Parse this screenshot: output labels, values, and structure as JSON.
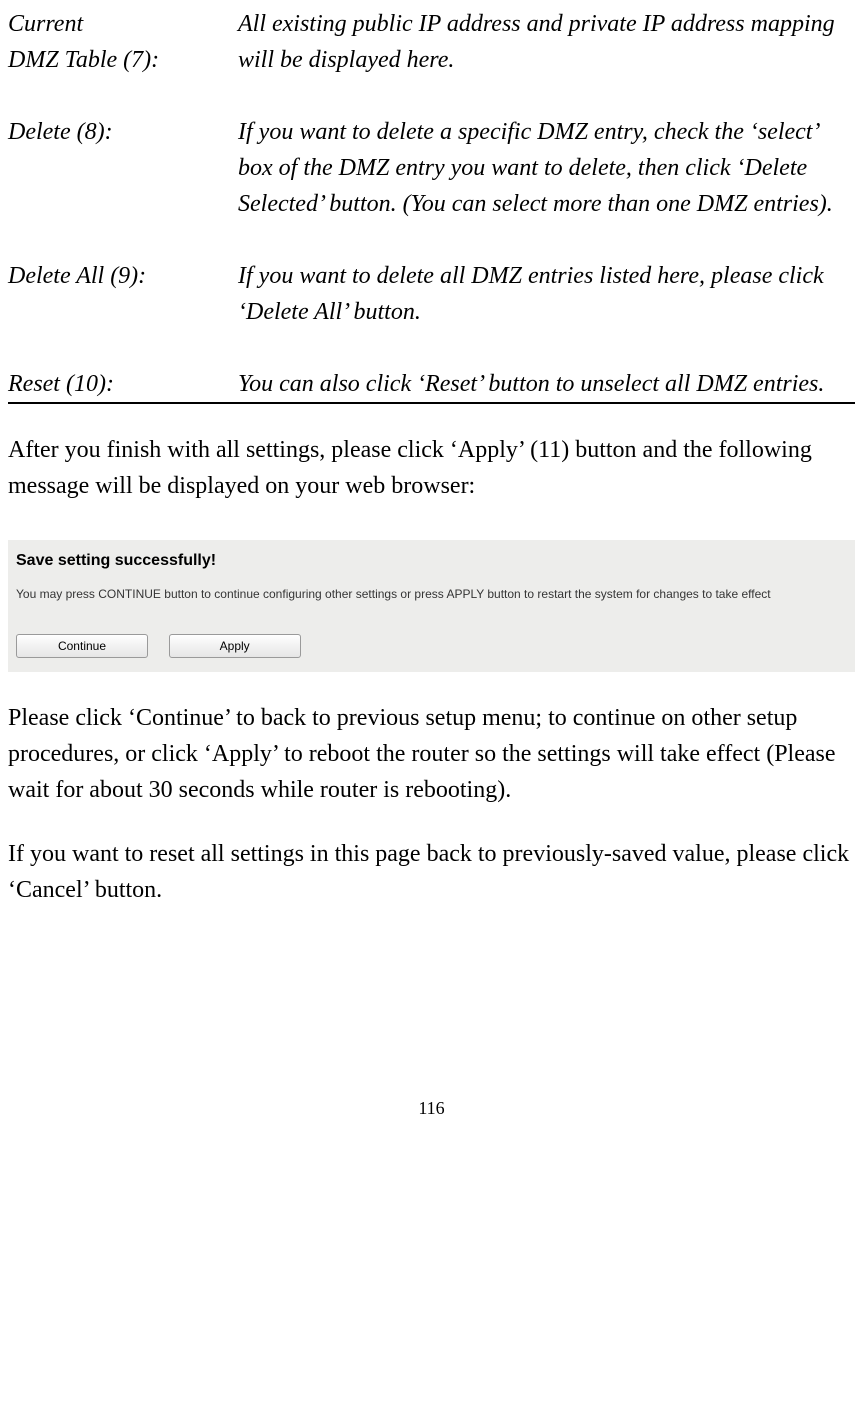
{
  "definitions": {
    "row1_term_line1": "Current",
    "row1_term_line2": "DMZ Table (7):",
    "row1_desc": "All existing public IP address and private IP address mapping will be displayed here.",
    "row2_term": "Delete (8):",
    "row2_desc": "If you want to delete a specific DMZ entry, check the ‘select’ box of the DMZ entry you want to delete, then click ‘Delete Selected’ button. (You can select more than one DMZ entries).",
    "row3_term": "Delete All (9):",
    "row3_desc": "If you want to delete all DMZ entries listed here, please click ‘Delete All’ button.",
    "row4_term": "Reset (10):",
    "row4_desc": "You can also click ‘Reset’ button to unselect all DMZ entries."
  },
  "paragraph1": "After you finish with all settings, please click ‘Apply’ (11) button and the following message will be displayed on your web browser:",
  "dialog": {
    "title": "Save setting successfully!",
    "body": "You may press CONTINUE button to continue configuring other settings or press APPLY button to restart the system for changes to take effect",
    "continue_label": "Continue",
    "apply_label": "Apply"
  },
  "paragraph2": "Please click ‘Continue’ to back to previous setup menu; to continue on other setup procedures, or click ‘Apply’ to reboot the router so the settings will take effect (Please wait for about 30 seconds while router is rebooting).",
  "paragraph3": "If you want to reset all settings in this page back to previously-saved value, please click ‘Cancel’ button.",
  "page_number": "116"
}
